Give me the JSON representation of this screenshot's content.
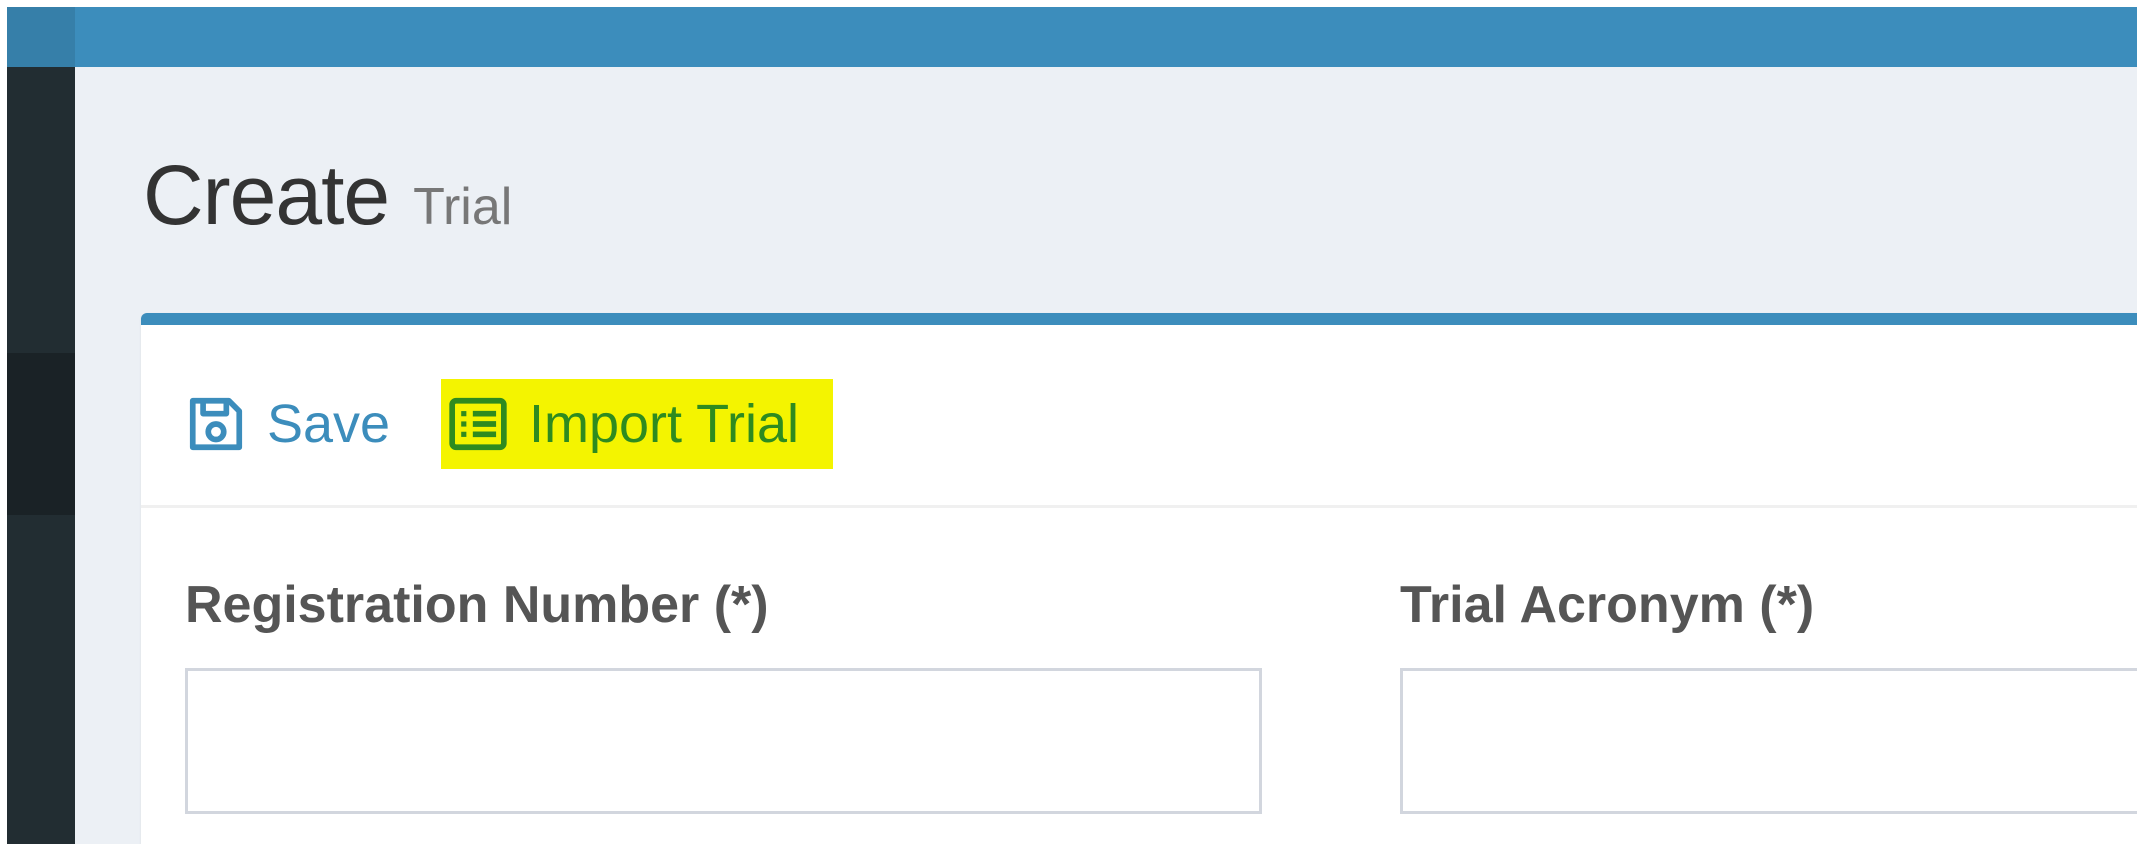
{
  "header": {
    "title": "Create",
    "subtitle": "Trial"
  },
  "toolbar": {
    "save_label": "Save",
    "save_icon": "floppy-disk-icon",
    "import_label": "Import Trial",
    "import_icon": "list-alt-icon"
  },
  "form": {
    "registration_number": {
      "label": "Registration Number (*)",
      "value": "",
      "placeholder": ""
    },
    "trial_acronym": {
      "label": "Trial Acronym (*)",
      "value": "",
      "placeholder": ""
    }
  },
  "colors": {
    "primary": "#3c8dbc",
    "sidebar": "#222d32",
    "content_bg": "#ecf0f5",
    "highlight": "#f4f400",
    "import_text": "#2e8b1f"
  }
}
